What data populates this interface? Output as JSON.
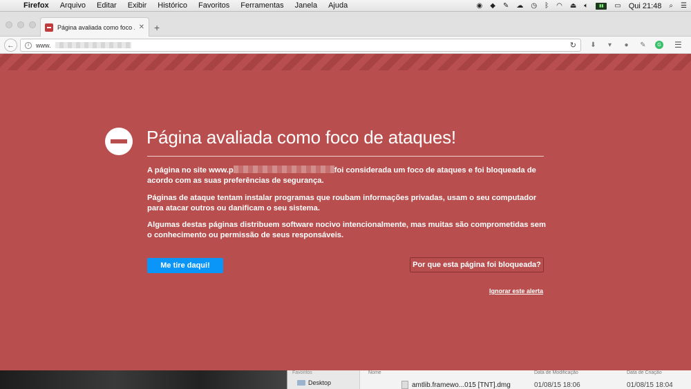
{
  "menubar": {
    "app_name": "Firefox",
    "items": [
      "Arquivo",
      "Editar",
      "Exibir",
      "Histórico",
      "Favoritos",
      "Ferramentas",
      "Janela",
      "Ajuda"
    ],
    "clock": "Qui 21:48"
  },
  "browser": {
    "tab_title": "Página avaliada como foco ...",
    "url_prefix": "www."
  },
  "page": {
    "title": "Página avaliada como foco de ataques!",
    "p1_before": "A página no site www.p",
    "p1_after": "foi considerada um foco de ataques e foi bloqueada de acordo com as suas preferências de segurança.",
    "p2": "Páginas de ataque tentam instalar programas que roubam informações privadas, usam o seu computador para atacar outros ou danificam o seu sistema.",
    "p3": "Algumas destas páginas distribuem software nocivo intencionalmente, mas muitas são comprometidas sem o conhecimento ou permissão de seus responsáveis.",
    "get_me_out_label": "Me tire daqui!",
    "why_blocked_label": "Por que esta página foi bloqueada?",
    "ignore_label": "Ignorar este alerta"
  },
  "finder": {
    "sidebar_heading": "Favoritos",
    "sidebar_item": "Desktop",
    "col_name": "Nome",
    "col_modified": "Data de Modificação",
    "col_created": "Data de Criação",
    "file_name": "amtlib.framewo...015 [TNT].dmg",
    "file_modified": "01/08/15 18:06",
    "file_created": "01/08/15 18:04"
  },
  "colors": {
    "page_background": "#b94e4e",
    "primary_button": "#0996f8"
  }
}
